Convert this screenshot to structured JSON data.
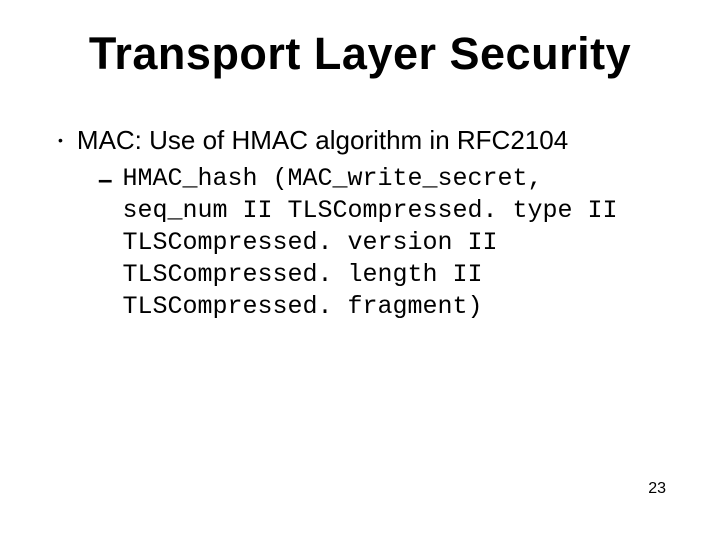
{
  "slide": {
    "title": "Transport Layer Security",
    "bullets": [
      {
        "text": "MAC: Use of HMAC algorithm in RFC2104",
        "sub": {
          "code": "HMAC_hash (MAC_write_secret,\nseq_num II TLSCompressed. type II\nTLSCompressed. version II\nTLSCompressed. length II\nTLSCompressed. fragment)"
        }
      }
    ],
    "page_number": "23"
  }
}
